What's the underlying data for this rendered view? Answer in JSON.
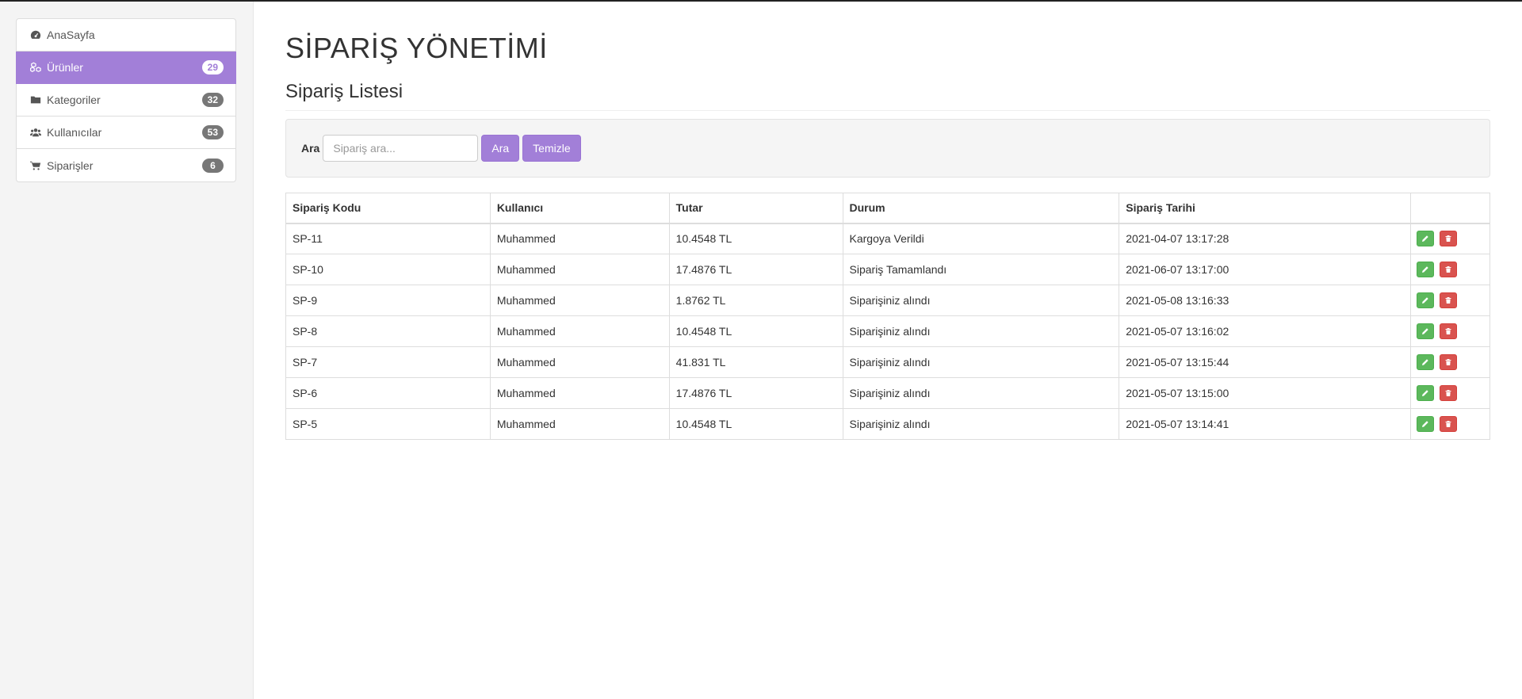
{
  "sidebar": {
    "items": [
      {
        "label": "AnaSayfa",
        "icon": "dashboard-icon",
        "badge": ""
      },
      {
        "label": "Ürünler",
        "icon": "cubes-icon",
        "badge": "29"
      },
      {
        "label": "Kategoriler",
        "icon": "folder-icon",
        "badge": "32"
      },
      {
        "label": "Kullanıcılar",
        "icon": "users-icon",
        "badge": "53"
      },
      {
        "label": "Siparişler",
        "icon": "cart-icon",
        "badge": "6"
      }
    ],
    "accent": "#a27fd8"
  },
  "page": {
    "title": "SİPARİŞ YÖNETİMİ",
    "subtitle": "Sipariş Listesi"
  },
  "search": {
    "label": "Ara",
    "placeholder": "Sipariş ara...",
    "search_button": "Ara",
    "clear_button": "Temizle"
  },
  "table": {
    "headers": [
      "Sipariş Kodu",
      "Kullanıcı",
      "Tutar",
      "Durum",
      "Sipariş Tarihi",
      ""
    ],
    "rows": [
      [
        "SP-11",
        "Muhammed",
        "10.4548 TL",
        "Kargoya Verildi",
        "2021-04-07 13:17:28"
      ],
      [
        "SP-10",
        "Muhammed",
        "17.4876 TL",
        "Sipariş Tamamlandı",
        "2021-06-07 13:17:00"
      ],
      [
        "SP-9",
        "Muhammed",
        "1.8762 TL",
        "Siparişiniz alındı",
        "2021-05-08 13:16:33"
      ],
      [
        "SP-8",
        "Muhammed",
        "10.4548 TL",
        "Siparişiniz alındı",
        "2021-05-07 13:16:02"
      ],
      [
        "SP-7",
        "Muhammed",
        "41.831 TL",
        "Siparişiniz alındı",
        "2021-05-07 13:15:44"
      ],
      [
        "SP-6",
        "Muhammed",
        "17.4876 TL",
        "Siparişiniz alındı",
        "2021-05-07 13:15:00"
      ],
      [
        "SP-5",
        "Muhammed",
        "10.4548 TL",
        "Siparişiniz alındı",
        "2021-05-07 13:14:41"
      ]
    ],
    "row_actions": [
      {
        "icon": "pencil-icon",
        "color": "#5cb85c"
      },
      {
        "icon": "trash-icon",
        "color": "#d9534f"
      }
    ]
  }
}
